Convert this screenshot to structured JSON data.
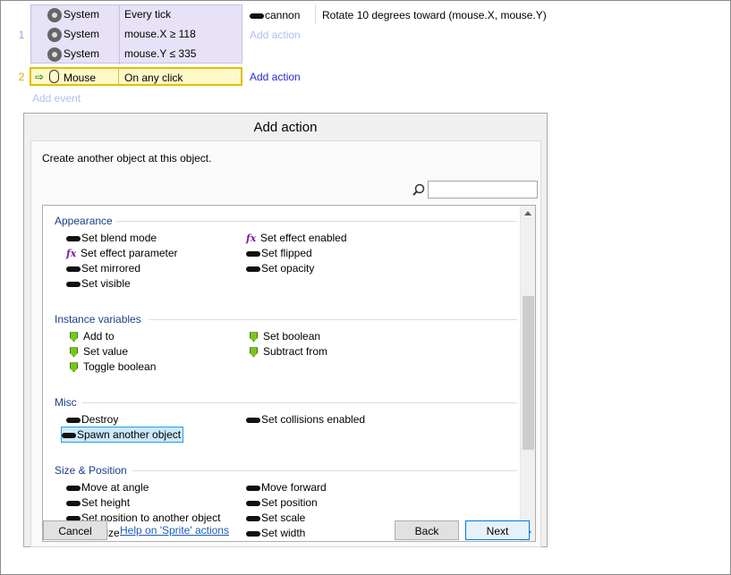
{
  "events": {
    "event1": {
      "row_number": "1",
      "conditions": [
        {
          "object": "System",
          "text": "Every tick"
        },
        {
          "object": "System",
          "text": "mouse.X ≥ 118"
        },
        {
          "object": "System",
          "text": "mouse.Y ≤ 335"
        }
      ],
      "action_object": "cannon",
      "action_text": "Rotate 10 degrees toward (mouse.X, mouse.Y)",
      "add_action": "Add action"
    },
    "event2": {
      "row_number": "2",
      "condition": {
        "object": "Mouse",
        "text": "On any click"
      },
      "add_action": "Add action"
    },
    "add_event": "Add event"
  },
  "dialog": {
    "title": "Add action",
    "description": "Create another object at this object.",
    "search_value": "",
    "categories": [
      {
        "name": "Appearance",
        "items": [
          {
            "label": "Set blend mode",
            "icon": "sprite-icon"
          },
          {
            "label": "Set effect enabled",
            "icon": "fx-icon"
          },
          {
            "label": "Set effect parameter",
            "icon": "fx-icon"
          },
          {
            "label": "Set flipped",
            "icon": "sprite-icon"
          },
          {
            "label": "Set mirrored",
            "icon": "sprite-icon"
          },
          {
            "label": "Set opacity",
            "icon": "sprite-icon"
          },
          {
            "label": "Set visible",
            "icon": "sprite-icon"
          }
        ]
      },
      {
        "name": "Instance variables",
        "items": [
          {
            "label": "Add to",
            "icon": "instance-variable-icon"
          },
          {
            "label": "Set boolean",
            "icon": "instance-variable-icon"
          },
          {
            "label": "Set value",
            "icon": "instance-variable-icon"
          },
          {
            "label": "Subtract from",
            "icon": "instance-variable-icon"
          },
          {
            "label": "Toggle boolean",
            "icon": "instance-variable-icon"
          }
        ]
      },
      {
        "name": "Misc",
        "items": [
          {
            "label": "Destroy",
            "icon": "sprite-icon"
          },
          {
            "label": "Set collisions enabled",
            "icon": "sprite-icon"
          },
          {
            "label": "Spawn another object",
            "icon": "sprite-icon",
            "selected": true
          }
        ]
      },
      {
        "name": "Size & Position",
        "items": [
          {
            "label": "Move at angle",
            "icon": "sprite-icon"
          },
          {
            "label": "Move forward",
            "icon": "sprite-icon"
          },
          {
            "label": "Set height",
            "icon": "sprite-icon"
          },
          {
            "label": "Set position",
            "icon": "sprite-icon"
          },
          {
            "label": "Set position to another object",
            "icon": "sprite-icon"
          },
          {
            "label": "Set scale",
            "icon": "sprite-icon"
          },
          {
            "label": "Set size",
            "icon": "sprite-icon"
          },
          {
            "label": "Set width",
            "icon": "sprite-icon"
          }
        ]
      }
    ],
    "buttons": {
      "cancel": "Cancel",
      "help": "Help on 'Sprite' actions",
      "back": "Back",
      "next": "Next"
    }
  },
  "colors": {
    "condition_bg": "#e7e2f7",
    "selected_event_border": "#e2c000",
    "link_blue": "#2a2ad0",
    "category_title": "#1a3f8a",
    "selection_bg": "#cce8ff"
  }
}
